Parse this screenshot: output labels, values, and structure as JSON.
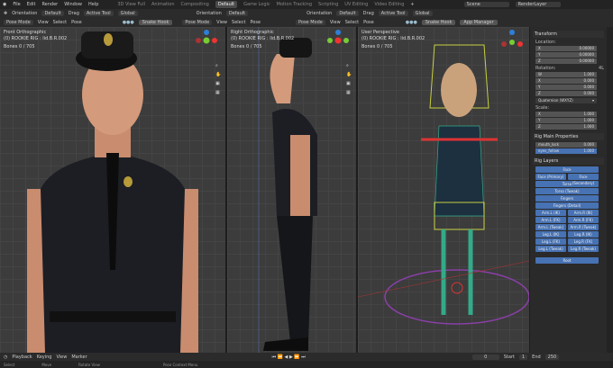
{
  "menu": {
    "items": [
      "File",
      "Edit",
      "Render",
      "Window",
      "Help"
    ],
    "workspaces": [
      "3D View Full",
      "Animation",
      "Compositing",
      "Default",
      "Game Logic",
      "Motion Tracking",
      "Scripting",
      "UV Editing",
      "Video Editing"
    ],
    "active_workspace": "Default",
    "scene": "Scene",
    "render_layer": "RenderLayer"
  },
  "header": {
    "orientation": "Orientation",
    "default": "Default",
    "drag": "Drag",
    "active_tool": "Active Tool",
    "global": "Global",
    "mode": "Pose Mode",
    "view": "View",
    "select": "Select",
    "pose": "Pose",
    "snake_hook": "Snake Hook",
    "app_manager": "App Manager"
  },
  "viewports": [
    {
      "title": "Front Orthographic",
      "object": "(0) ROOKIE RIG : lid.B.R.002",
      "bones_label": "Bones",
      "bones": "0 / 705"
    },
    {
      "title": "Right Orthographic",
      "object": "(0) ROOKIE RIG : lid.B.R.002",
      "bones_label": "Bones",
      "bones": "0 / 705"
    },
    {
      "title": "User Perspective",
      "object": "(0) ROOKIE RIG : lid.B.R.002",
      "bones_label": "Bones",
      "bones": "0 / 705"
    }
  ],
  "sidebar": {
    "transform": "Transform",
    "location": "Location:",
    "loc": [
      [
        "X",
        "0.00000"
      ],
      [
        "Y",
        "0.00000"
      ],
      [
        "Z",
        "0.00000"
      ]
    ],
    "rotation": "Rotation:",
    "rot_mode_short": "4L",
    "rot": [
      [
        "W",
        "1.000"
      ],
      [
        "X",
        "0.000"
      ],
      [
        "Y",
        "0.000"
      ],
      [
        "Z",
        "0.000"
      ]
    ],
    "rot_mode": "Quaternion (WXYZ)",
    "scale": "Scale:",
    "scl": [
      [
        "X",
        "1.000"
      ],
      [
        "Y",
        "1.000"
      ],
      [
        "Z",
        "1.000"
      ]
    ],
    "rig_main": "Rig Main Properties",
    "props": [
      [
        "mouth_lock",
        "0.000"
      ],
      [
        "eyes_follow",
        "1.000"
      ]
    ],
    "rig_layers": "Rig Layers",
    "layers": [
      [
        "Face"
      ],
      [
        "Face (Primary)",
        "Face (Secondary)"
      ],
      [
        "Torso"
      ],
      [
        "Torso (Tweak)"
      ],
      [
        "Fingers"
      ],
      [
        "Fingers (Detail)"
      ],
      [
        "Arm.L (IK)",
        "Arm.R (IK)"
      ],
      [
        "Arm.L (FK)",
        "Arm.R (FK)"
      ],
      [
        "Arm.L (Tweak)",
        "Arm.R (Tweak)"
      ],
      [
        "Leg.L (IK)",
        "Leg.R (IK)"
      ],
      [
        "Leg.L (FK)",
        "Leg.R (FK)"
      ],
      [
        "Leg.L (Tweak)",
        "Leg.R (Tweak)"
      ]
    ],
    "root": "Root"
  },
  "timeline": {
    "playback": "Playback",
    "keying": "Keying",
    "view": "View",
    "marker": "Marker",
    "frame": "0",
    "start_label": "Start",
    "start": "1",
    "end_label": "End",
    "end": "250"
  },
  "status": {
    "select": "Select",
    "move": "Move",
    "rotate": "Rotate View",
    "context": "Pose Context Menu"
  }
}
